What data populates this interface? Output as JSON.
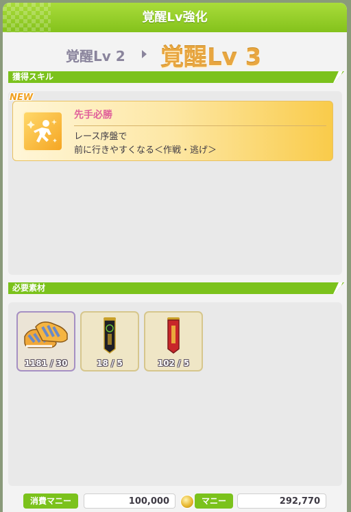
{
  "dialog": {
    "title": "覚醒Lv強化"
  },
  "level": {
    "from": "覚醒Lv 2",
    "to": "覚醒Lv 3"
  },
  "acquired_skill": {
    "section_label": "獲得スキル",
    "new_tag": "NEW",
    "name": "先手必勝",
    "description_line1": "レース序盤で",
    "description_line2": "前に行きやすくなる＜作戦・逃げ＞",
    "icon": "running-skill-icon"
  },
  "materials": {
    "section_label": "必要素材",
    "items": [
      {
        "icon": "shoes-icon",
        "count": "1181 / 30"
      },
      {
        "icon": "black-pennant-icon",
        "count": "18 / 5"
      },
      {
        "icon": "red-pennant-icon",
        "count": "102 / 5"
      }
    ]
  },
  "money": {
    "cost_label": "消費マニー",
    "cost_value": "100,000",
    "balance_label": "マニー",
    "balance_value": "292,770"
  },
  "colors": {
    "accent_green": "#7bc21c",
    "level_gold": "#e8a640",
    "skill_name_pink": "#e0609a"
  }
}
